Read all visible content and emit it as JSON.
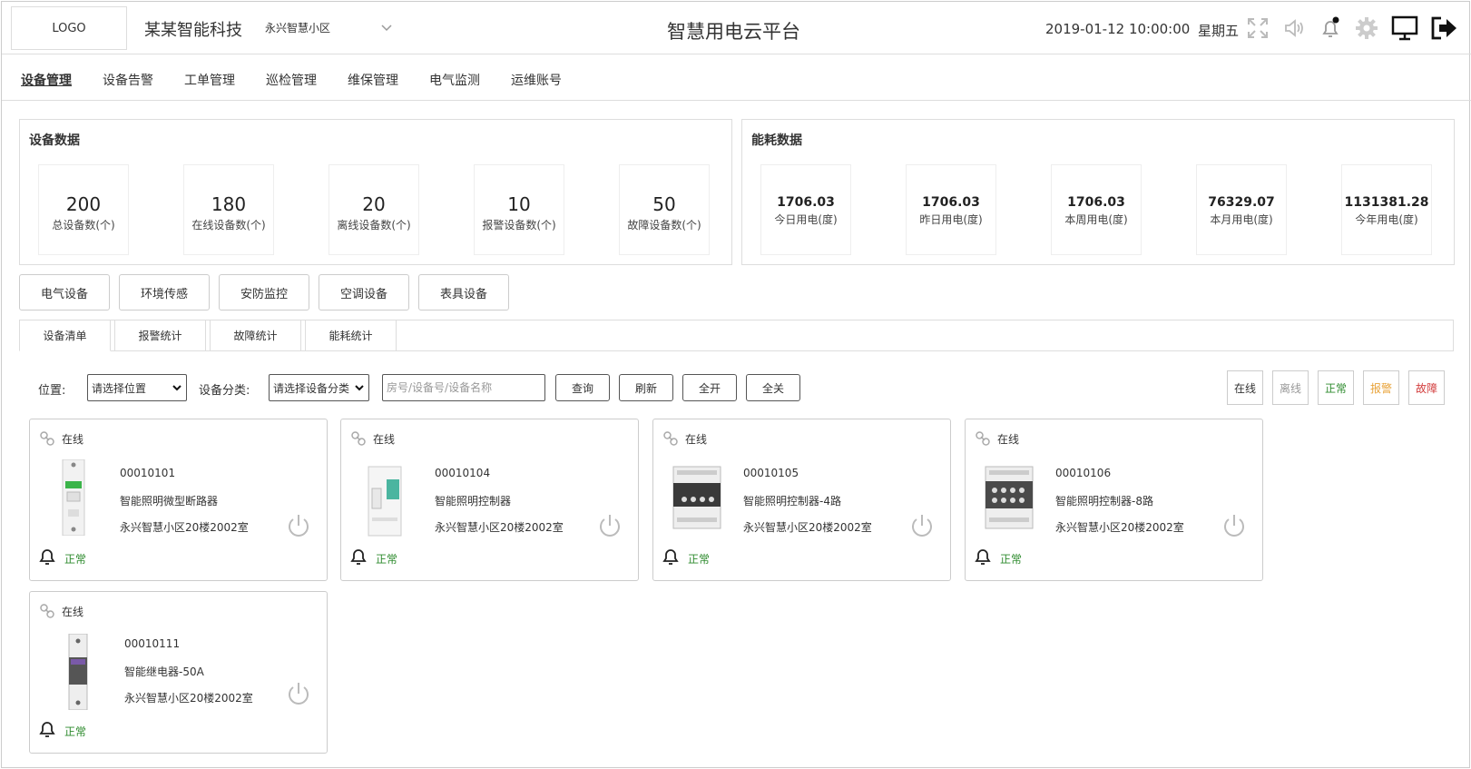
{
  "header": {
    "logo": "LOGO",
    "company": "某某智能科技",
    "community": "永兴智慧小区",
    "title": "智慧用电云平台",
    "datetime": "2019-01-12 10:00:00",
    "weekday": "星期五",
    "icons": [
      "fullscreen-icon",
      "volume-icon",
      "bell-icon",
      "gear-icon",
      "monitor-icon",
      "logout-icon"
    ]
  },
  "nav": [
    "设备管理",
    "设备告警",
    "工单管理",
    "巡检管理",
    "维保管理",
    "电气监测",
    "运维账号"
  ],
  "device_panel": {
    "title": "设备数据",
    "stats": [
      {
        "value": "200",
        "label": "总设备数(个)"
      },
      {
        "value": "180",
        "label": "在线设备数(个)"
      },
      {
        "value": "20",
        "label": "离线设备数(个)"
      },
      {
        "value": "10",
        "label": "报警设备数(个)"
      },
      {
        "value": "50",
        "label": "故障设备数(个)"
      }
    ]
  },
  "energy_panel": {
    "title": "能耗数据",
    "stats": [
      {
        "value": "1706.03",
        "label": "今日用电(度)"
      },
      {
        "value": "1706.03",
        "label": "昨日用电(度)"
      },
      {
        "value": "1706.03",
        "label": "本周用电(度)"
      },
      {
        "value": "76329.07",
        "label": "本月用电(度)"
      },
      {
        "value": "1131381.28",
        "label": "今年用电(度)"
      }
    ]
  },
  "categories": [
    "电气设备",
    "环境传感",
    "安防监控",
    "空调设备",
    "表具设备"
  ],
  "tabs": [
    "设备清单",
    "报警统计",
    "故障统计",
    "能耗统计"
  ],
  "filters": {
    "location_label": "位置:",
    "location_value": "请选择位置",
    "category_label": "设备分类:",
    "category_value": "请选择设备分类",
    "search_placeholder": "房号/设备号/设备名称",
    "query": "查询",
    "refresh": "刷新",
    "all_on": "全开",
    "all_off": "全关"
  },
  "status_filters": [
    {
      "label": "在线",
      "color": "#333333"
    },
    {
      "label": "离线",
      "color": "#999999"
    },
    {
      "label": "正常",
      "color": "#2e8b2e"
    },
    {
      "label": "报警",
      "color": "#e8a33a"
    },
    {
      "label": "故障",
      "color": "#d23c3c"
    }
  ],
  "devices": [
    {
      "state": "在线",
      "id": "00010101",
      "name": "智能照明微型断路器",
      "location": "永兴智慧小区20楼2002室",
      "status": "正常",
      "image": "breaker-icon"
    },
    {
      "state": "在线",
      "id": "00010104",
      "name": "智能照明控制器",
      "location": "永兴智慧小区20楼2002室",
      "status": "正常",
      "image": "controller-icon"
    },
    {
      "state": "在线",
      "id": "00010105",
      "name": "智能照明控制器-4路",
      "location": "永兴智慧小区20楼2002室",
      "status": "正常",
      "image": "controller-4-icon"
    },
    {
      "state": "在线",
      "id": "00010106",
      "name": "智能照明控制器-8路",
      "location": "永兴智慧小区20楼2002室",
      "status": "正常",
      "image": "controller-8-icon"
    },
    {
      "state": "在线",
      "id": "00010111",
      "name": "智能继电器-50A",
      "location": "永兴智慧小区20楼2002室",
      "status": "正常",
      "image": "relay-icon"
    }
  ]
}
